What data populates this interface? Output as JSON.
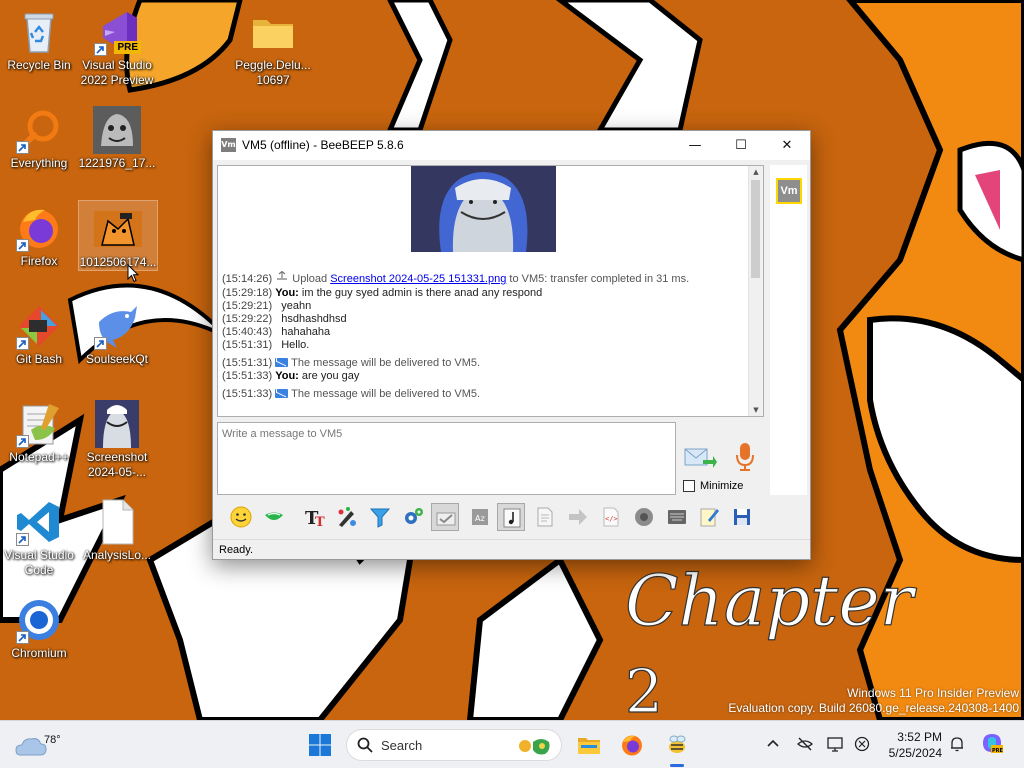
{
  "desktop": {
    "icons": [
      {
        "label": "Recycle Bin",
        "icon": "recycle-bin-icon"
      },
      {
        "label": "Visual Studio 2022 Preview",
        "icon": "visual-studio-preview-icon",
        "badge": "PRE"
      },
      {
        "label": "Peggle.Delu... 10697",
        "icon": "folder-icon"
      },
      {
        "label": "Everything",
        "icon": "everything-search-icon"
      },
      {
        "label": "1221976_17...",
        "icon": "image-file-icon"
      },
      {
        "label": "Firefox",
        "icon": "firefox-icon"
      },
      {
        "label": "1012506174...",
        "icon": "image-file-icon"
      },
      {
        "label": "Git Bash",
        "icon": "git-bash-icon"
      },
      {
        "label": "SoulseekQt",
        "icon": "soulseek-icon"
      },
      {
        "label": "Notepad++",
        "icon": "notepad-plus-plus-icon"
      },
      {
        "label": "Screenshot 2024-05-...",
        "icon": "screenshot-file-icon"
      },
      {
        "label": "Visual Studio Code",
        "icon": "vscode-icon"
      },
      {
        "label": "AnalysisLo...",
        "icon": "text-file-icon"
      },
      {
        "label": "Chromium",
        "icon": "chromium-icon"
      }
    ]
  },
  "window": {
    "title": "VM5 (offline) - BeeBEEP 5.8.6",
    "icon_text": "Vm",
    "controls": {
      "minimize": "—",
      "maximize": "☐",
      "close": "✕"
    }
  },
  "chat": {
    "upload": {
      "time": "(15:14:26)",
      "prefix": "Upload",
      "file": "Screenshot 2024-05-25 151331.png",
      "suffix": "to VM5: transfer completed in 31 ms."
    },
    "messages": [
      {
        "time": "(15:29:18)",
        "sender": "You:",
        "text": "im the guy syed admin is there anad any respond"
      },
      {
        "time": "(15:29:21)",
        "sender": "",
        "text": "yeahn"
      },
      {
        "time": "(15:29:22)",
        "sender": "",
        "text": "hsdhashdhsd"
      },
      {
        "time": "(15:40:43)",
        "sender": "",
        "text": "hahahaha"
      },
      {
        "time": "(15:51:31)",
        "sender": "",
        "text": "Hello."
      },
      {
        "time": "(15:51:31)",
        "system": true,
        "text": "The message will be delivered to VM5."
      },
      {
        "time": "(15:51:33)",
        "sender": "You:",
        "text": "are you gay"
      },
      {
        "time": "(15:51:33)",
        "system": true,
        "text": "The message will be delivered to VM5."
      }
    ]
  },
  "compose": {
    "placeholder": "Write a message to VM5",
    "minimize_label": "Minimize",
    "minimize_checked": false
  },
  "side_panel": {
    "user_badge": "Vm"
  },
  "toolbar": {
    "tools": [
      "emoticon-icon",
      "emoji-green-icon",
      "text-font-icon",
      "color-picker-icon",
      "filter-icon",
      "settings-gear-icon",
      "spell-check-icon",
      "dictionary-icon",
      "music-note-icon",
      "document-icon",
      "forward-icon",
      "html-code-icon",
      "screenshot-icon",
      "keyboard-icon",
      "notes-icon",
      "save-icon"
    ],
    "pressed_tools": [
      "spell-check-icon",
      "music-note-icon"
    ]
  },
  "status": {
    "text": "Ready."
  },
  "wallpaper": {
    "text": "Chapter",
    "subtext": "2"
  },
  "watermark": {
    "line1": "Windows 11 Pro Insider Preview",
    "line2": "Evaluation copy. Build 26080.ge_release.240308-1400"
  },
  "taskbar": {
    "weather_temp": "78°",
    "search_placeholder": "Search",
    "apps": [
      "start-icon",
      "file-explorer-icon",
      "firefox-icon",
      "beebeep-icon"
    ],
    "active_app": "beebeep-icon",
    "tray": [
      "chevron-up-icon",
      "network-off-icon",
      "display-icon",
      "accessibility-icon"
    ],
    "time": "3:52 PM",
    "date": "5/25/2024"
  },
  "colors": {
    "wallpaper_bg": "#c8650e",
    "link": "#0000ee",
    "accent": "#2b6be0",
    "badge_border": "#ffd700"
  }
}
